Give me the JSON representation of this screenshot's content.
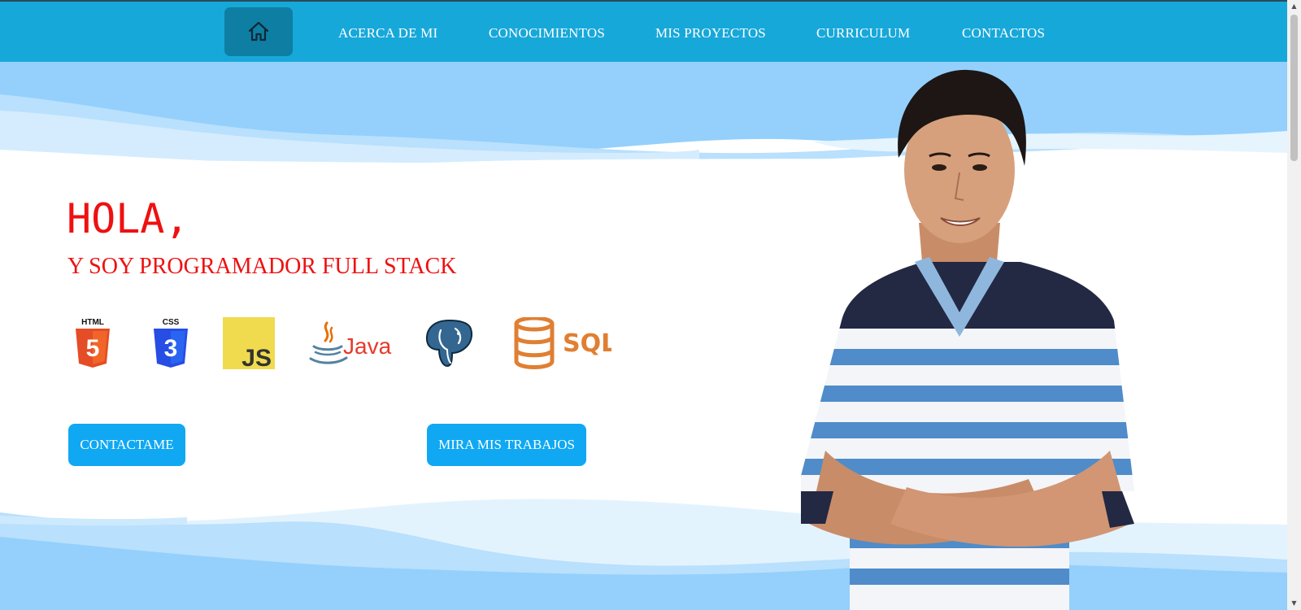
{
  "nav": {
    "home_icon": "home-icon",
    "links": [
      "ACERCA DE MI",
      "CONOCIMIENTOS",
      "MIS PROYECTOS",
      "CURRICULUM",
      "CONTACTOS"
    ]
  },
  "hero": {
    "greeting": "HOLA,",
    "subtitle": "Y SOY PROGRAMADOR FULL STACK",
    "buttons": {
      "contact": "CONTACTAME",
      "works": "MIRA MIS TRABAJOS"
    }
  },
  "skills": {
    "html": "HTML",
    "html_number": "5",
    "css": "CSS",
    "css_number": "3",
    "js": "JS",
    "java": "Java",
    "sql": "SQL",
    "postgres_icon": "postgresql-elephant-icon"
  },
  "colors": {
    "nav_bg": "#17a8da",
    "home_btn_bg": "#0f7ea3",
    "accent_red": "#ee1111",
    "button_blue": "#10a8f2",
    "wave_blue": "#94d0fb"
  },
  "scrollbar": {
    "up": "▲",
    "down": "▼"
  }
}
